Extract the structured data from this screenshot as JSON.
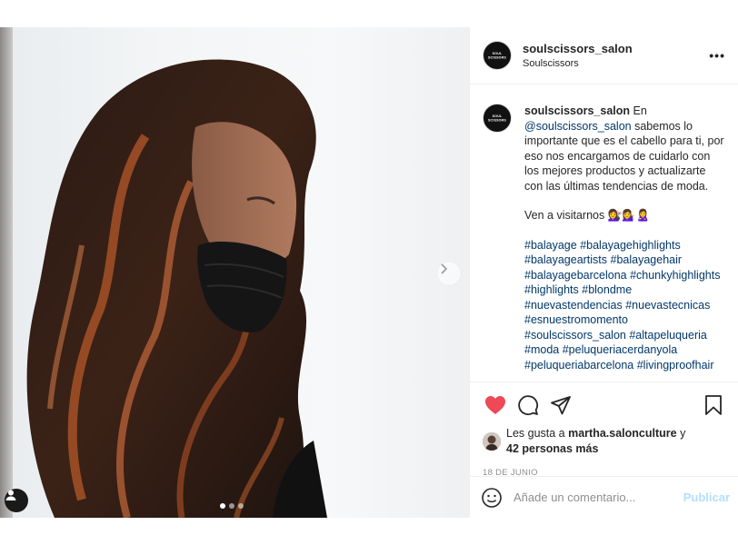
{
  "colors": {
    "like_red": "#ed4956",
    "link_blue": "#00376b",
    "publish_blue": "#b2dffc",
    "muted": "#8e8e8e"
  },
  "photo": {
    "carousel": {
      "total": 3,
      "current": 1
    },
    "icons": {
      "next": "chevron-right-icon",
      "tagged_users": "user-icon"
    }
  },
  "header": {
    "username": "soulscissors_salon",
    "subtitle": "Soulscissors",
    "avatar_text": "SOUL SCISSORS",
    "more": "•••"
  },
  "caption": {
    "username": "soulscissors_salon",
    "intro": " En ",
    "mention": "@soulscissors_salon",
    "body": " sabemos lo importante que es el cabello para ti, por eso nos encargamos de cuidarlo con los mejores productos y actualizarte con las últimas tendencias de moda.",
    "visit": "Ven a visitarnos 💇‍♀️💁‍♀️🙎‍♀️",
    "hashtags": [
      "#balayage",
      "#balayagehighlights",
      "#balayageartists",
      "#balayagehair",
      "#balayagebarcelona",
      "#chunkyhighlights",
      "#highlights",
      "#blondme",
      "#nuevastendencias",
      "#nuevastecnicas",
      "#esnuestromomento",
      "#soulscissors_salon",
      "#altapeluqueria",
      "#moda",
      "#peluqueriacerdanyola",
      "#peluqueriabarcelona",
      "#livingproofhair"
    ]
  },
  "actions": {
    "icons": {
      "like": "heart-icon",
      "comment": "comment-icon",
      "share": "paper-plane-icon",
      "save": "bookmark-icon"
    },
    "liked": true
  },
  "likes": {
    "prefix": "Les gusta a ",
    "user": "martha.salonculture",
    "joiner": " y",
    "others": "42 personas más"
  },
  "date": "18 DE JUNIO",
  "comment_box": {
    "placeholder": "Añade un comentario...",
    "publish": "Publicar",
    "emoji_icon": "smiley-icon"
  }
}
